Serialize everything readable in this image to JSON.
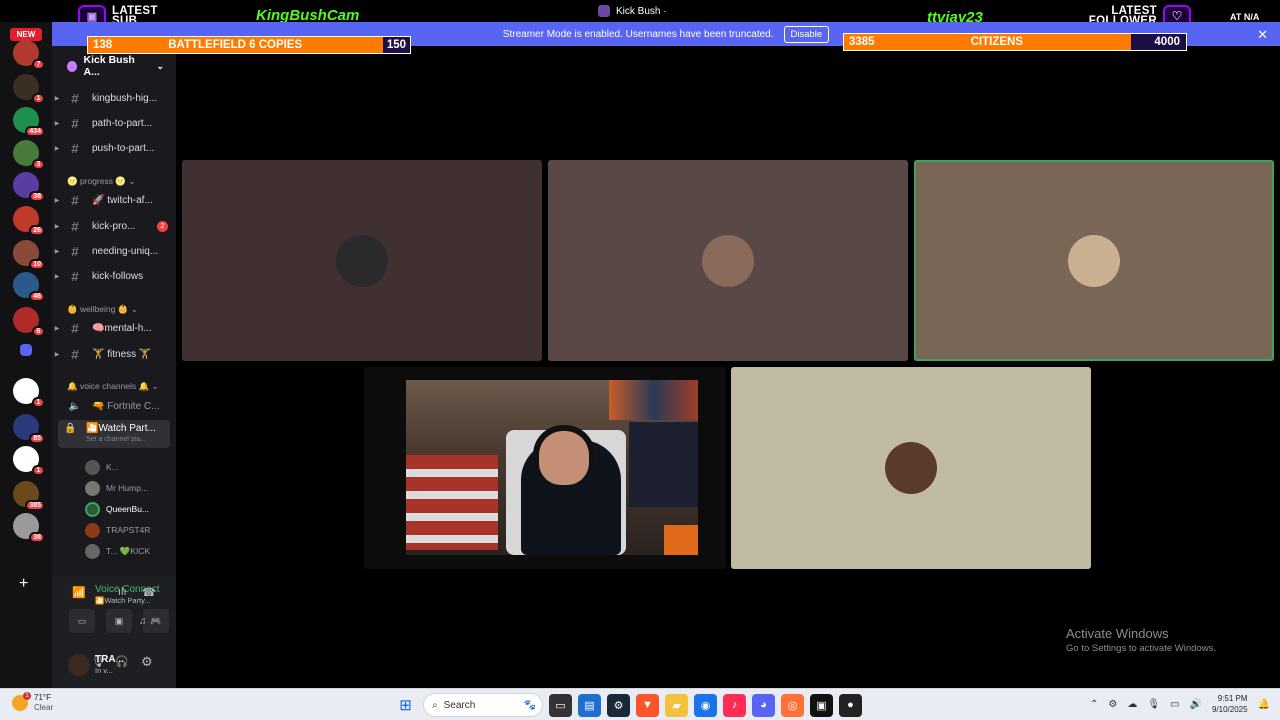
{
  "overlay": {
    "latest_sub_label": "LATEST SUB",
    "latest_sub_name": "KingBushCam",
    "center_title": "Kick Bush ·",
    "latest_follower_name": "ttvjay23",
    "latest_follower_label": "LATEST FOLLOWER",
    "right_label": "AT N/A",
    "goal_left": {
      "current": 138,
      "label": "BATTLEFIELD 6 COPIES",
      "max": 150,
      "progress": 0.92
    },
    "goal_right": {
      "current": 3385,
      "label": "CITIZENS",
      "max": 4000,
      "progress": 0.846
    }
  },
  "banner": {
    "message": "Streamer Mode is enabled. Usernames have been truncated.",
    "disable_label": "Disable",
    "close": "✕"
  },
  "rail": {
    "new_badge": "NEW",
    "servers": [
      {
        "badge": "7",
        "color": "#b03a2e"
      },
      {
        "badge": "1",
        "color": "#3b2f24"
      },
      {
        "badge": "434",
        "color": "#1e8f4e"
      },
      {
        "badge": "3",
        "color": "#4a7a3a"
      },
      {
        "badge": "38",
        "color": "#5b3ca0"
      },
      {
        "badge": "26",
        "color": "#c0392b"
      },
      {
        "badge": "10",
        "color": "#8a4a3a"
      },
      {
        "badge": "46",
        "color": "#2a5a8a"
      },
      {
        "badge": "6",
        "color": "#b02a2a"
      },
      {
        "badge": "",
        "color": "#5865f2"
      },
      {
        "badge": "1",
        "color": "#ffffff"
      },
      {
        "badge": "85",
        "color": "#2a3a7a"
      },
      {
        "badge": "1",
        "color": "#ffffff"
      },
      {
        "badge": "385",
        "color": "#6a4a1a"
      },
      {
        "badge": "38",
        "color": "#9a9a9a"
      }
    ],
    "add": "+"
  },
  "sidebar": {
    "server_name": "Kick Bush A...",
    "channels_top": [
      {
        "name": "kingbush-hig..."
      },
      {
        "name": "path-to-part..."
      },
      {
        "name": "push-to-part..."
      }
    ],
    "category_progress": "🌝 progress 🌝",
    "channels_progress": [
      {
        "name": "🚀 twitch-af...",
        "count": ""
      },
      {
        "name": "kick-pro...",
        "count": "2"
      },
      {
        "name": "needing-uniq...",
        "count": ""
      },
      {
        "name": "kick-follows",
        "count": ""
      }
    ],
    "category_wellbeing": "👶 wellbeing 👶",
    "channels_wellbeing": [
      {
        "name": "🧠mental-h..."
      },
      {
        "name": "🏋 fitness 🏋"
      }
    ],
    "category_voice": "🔔 voice channels 🔔",
    "voice_fortnite": "🔫 Fortnite C...",
    "voice_watch": "🎦Watch Part...",
    "voice_watch_sub": "Set a channel sta...",
    "members": [
      {
        "name": "K...",
        "color": "#555"
      },
      {
        "name": "Mr Hump...",
        "color": "#777"
      },
      {
        "name": "QueenBu...",
        "color": "#3ba55c",
        "bright": true
      },
      {
        "name": "TRAPST4R",
        "color": "#8a3a1a"
      },
      {
        "name": "T... 💚KICK",
        "color": "#666"
      }
    ]
  },
  "voice_panel": {
    "connected": "Voice Connect",
    "channel": "🎦Watch Party...",
    "user_name": "TRA...",
    "user_status": "In v..."
  },
  "call": {
    "tiles": [
      {
        "color": "#403032",
        "face": "#2a2a2a"
      },
      {
        "color": "#5a4846",
        "face": "#8a6a5a"
      },
      {
        "color": "#7a6656",
        "face": "#c8b090",
        "speaking": true
      },
      {
        "color": "#c2bba4",
        "face": "#5a3a2a"
      }
    ]
  },
  "watermark": {
    "title": "Activate Windows",
    "subtitle": "Go to Settings to activate Windows."
  },
  "taskbar": {
    "weather_temp": "71°F",
    "weather_cond": "Clear",
    "weather_badge": "1",
    "search_placeholder": "Search",
    "time": "9:51 PM",
    "date": "9/10/2025"
  }
}
